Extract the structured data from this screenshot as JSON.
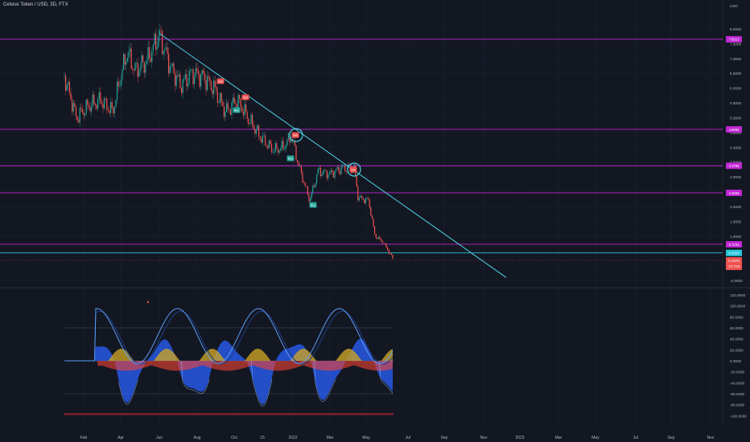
{
  "title": "Celsius Token / USD, 3D, FTX",
  "currency": "USD",
  "colors": {
    "background": "#131722",
    "up": "#26a69a",
    "down": "#ef5350",
    "resistance": "#c026d3",
    "trendline": "#4dd0e1",
    "support": "#26c6da",
    "wave_fast": "#5b9cf6",
    "wave_slow": "#1e3f8a",
    "osc_blue": "#2962ff",
    "osc_yellow": "#c9a227",
    "osc_red": "#f44336"
  },
  "chart_data": {
    "type": "line",
    "price_axis": {
      "ticks": [
        "8.0000",
        "7.5000",
        "7.0000",
        "6.5000",
        "6.0000",
        "5.5000",
        "5.0000",
        "4.5000",
        "4.0000",
        "3.5000",
        "3.0000",
        "2.5000",
        "2.0000",
        "1.5000",
        "1.0000",
        "0.5000",
        "0.0000",
        "-0.5000"
      ],
      "range": [
        -0.5,
        8.0
      ]
    },
    "time_axis": {
      "ticks": [
        "Feb",
        "Apr",
        "Jun",
        "Aug",
        "Oct",
        "15",
        "2022",
        "Mar",
        "May",
        "Jul",
        "Sep",
        "Nov",
        "2023",
        "Mar",
        "May",
        "Jul",
        "Sep",
        "Nov"
      ]
    },
    "horizontal_levels": [
      {
        "label": "7.6513",
        "value": 7.6513,
        "kind": "resistance"
      },
      {
        "label": "4.6060",
        "value": 4.606,
        "kind": "resistance"
      },
      {
        "label": "3.3765",
        "value": 3.3765,
        "kind": "resistance"
      },
      {
        "label": "2.4609",
        "value": 2.4609,
        "kind": "resistance"
      },
      {
        "label": "0.7233",
        "value": 0.7233,
        "kind": "resistance"
      },
      {
        "label": "0.4313",
        "value": 0.4313,
        "kind": "support"
      }
    ],
    "current_price": {
      "label": "0.1979",
      "change": "-17.71%",
      "value": 0.1979
    },
    "trendline": {
      "from": {
        "x": "Jun",
        "y": 7.85
      },
      "to": {
        "x": "Dec 2022",
        "y": -0.4
      }
    },
    "price_series": [
      {
        "x": "Jan",
        "close": 6.3
      },
      {
        "x": "Feb",
        "close": 4.9
      },
      {
        "x": "Mar",
        "close": 5.4
      },
      {
        "x": "Apr",
        "close": 6.7
      },
      {
        "x": "May",
        "close": 7.2
      },
      {
        "x": "Jun",
        "close": 7.8
      },
      {
        "x": "Jul",
        "close": 5.4
      },
      {
        "x": "Aug",
        "close": 6.1
      },
      {
        "x": "Sep",
        "close": 6.2
      },
      {
        "x": "Oct",
        "close": 5.7
      },
      {
        "x": "Nov",
        "close": 4.5
      },
      {
        "x": "Dec",
        "close": 4.0
      },
      {
        "x": "2022",
        "close": 4.4
      },
      {
        "x": "Jan 22",
        "close": 2.3
      },
      {
        "x": "Feb 22",
        "close": 3.1
      },
      {
        "x": "Mar 22",
        "close": 3.3
      },
      {
        "x": "Apr 22",
        "close": 2.5
      },
      {
        "x": "May 22",
        "close": 0.75
      },
      {
        "x": "Jun 22",
        "close": 0.2
      }
    ],
    "signals": [
      {
        "label": "Sell",
        "x": "Sep",
        "y": 6.4
      },
      {
        "label": "Sell",
        "x": "Oct",
        "y": 5.6
      },
      {
        "label": "Buy",
        "x": "Sep",
        "y": 5.2
      },
      {
        "label": "Sell",
        "x": "2022",
        "y": 4.4
      },
      {
        "label": "Buy",
        "x": "2022",
        "y": 3.6
      },
      {
        "label": "Buy",
        "x": "Jan 22",
        "y": 2.0
      },
      {
        "label": "Sell",
        "x": "Apr 22",
        "y": 3.35
      }
    ],
    "oscillator": {
      "ticks": [
        "120.0000",
        "100.0000",
        "80.0000",
        "60.0000",
        "40.0000",
        "20.0000",
        "0.0000",
        "-20.0000",
        "-40.0000",
        "-60.0000",
        "-80.0000",
        "-100.0000"
      ],
      "range": [
        -100,
        120
      ]
    }
  }
}
